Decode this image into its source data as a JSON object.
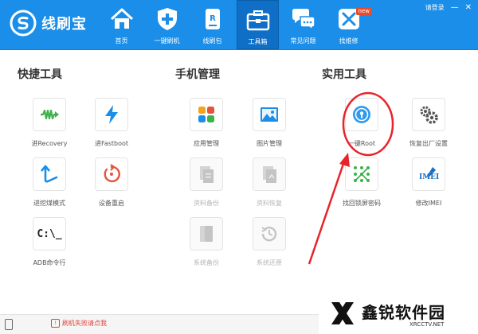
{
  "app": {
    "name": "线刷宝"
  },
  "top_bar": {
    "login": "请登录",
    "minimize": "—",
    "close": "✕"
  },
  "nav": [
    {
      "label": "首页",
      "icon": "home-icon"
    },
    {
      "label": "一键刷机",
      "icon": "shield-plus-icon"
    },
    {
      "label": "线刷包",
      "icon": "rom-package-icon"
    },
    {
      "label": "工具箱",
      "icon": "toolbox-icon",
      "active": true
    },
    {
      "label": "常见问题",
      "icon": "chat-bubbles-icon"
    },
    {
      "label": "找维修",
      "icon": "repair-icon",
      "badge": "new"
    }
  ],
  "sections": {
    "quick": {
      "title": "快捷工具"
    },
    "phone": {
      "title": "手机管理"
    },
    "utility": {
      "title": "实用工具"
    }
  },
  "tools": {
    "recovery": {
      "label": "进Recovery",
      "icon": "recovery-wave-icon"
    },
    "fastboot": {
      "label": "进Fastboot",
      "icon": "lightning-icon"
    },
    "deepflash": {
      "label": "进挖煤模式",
      "icon": "arrow-up-curve-icon"
    },
    "reboot": {
      "label": "设备重启",
      "icon": "restart-icon"
    },
    "adb": {
      "label": "ADB命令行",
      "icon": "terminal-icon",
      "glyph": "C:\\_"
    },
    "apps": {
      "label": "应用管理",
      "icon": "app-grid-icon"
    },
    "photos": {
      "label": "图片管理",
      "icon": "picture-icon"
    },
    "backup": {
      "label": "资料备份",
      "icon": "document-backup-icon"
    },
    "restore": {
      "label": "资料恢复",
      "icon": "document-restore-icon"
    },
    "sysbackup": {
      "label": "系统备份",
      "icon": "system-backup-icon"
    },
    "sysrestore": {
      "label": "系统还原",
      "icon": "history-icon"
    },
    "root": {
      "label": "一键Root",
      "icon": "root-lock-icon"
    },
    "factory": {
      "label": "恢复出厂设置",
      "icon": "gears-icon"
    },
    "unlock": {
      "label": "找回锁屏密码",
      "icon": "pattern-lock-icon"
    },
    "imei": {
      "label": "修改IMEI",
      "icon": "imei-edit-icon",
      "glyph": "IMEI"
    }
  },
  "footer": {
    "link": "刷机失败请点我"
  },
  "watermark": {
    "name": "鑫锐软件园",
    "url": "XRCCTV.NET"
  },
  "colors": {
    "header": "#1a8ee8",
    "active_nav": "#0f6fc6",
    "annotation": "#e8232a"
  }
}
